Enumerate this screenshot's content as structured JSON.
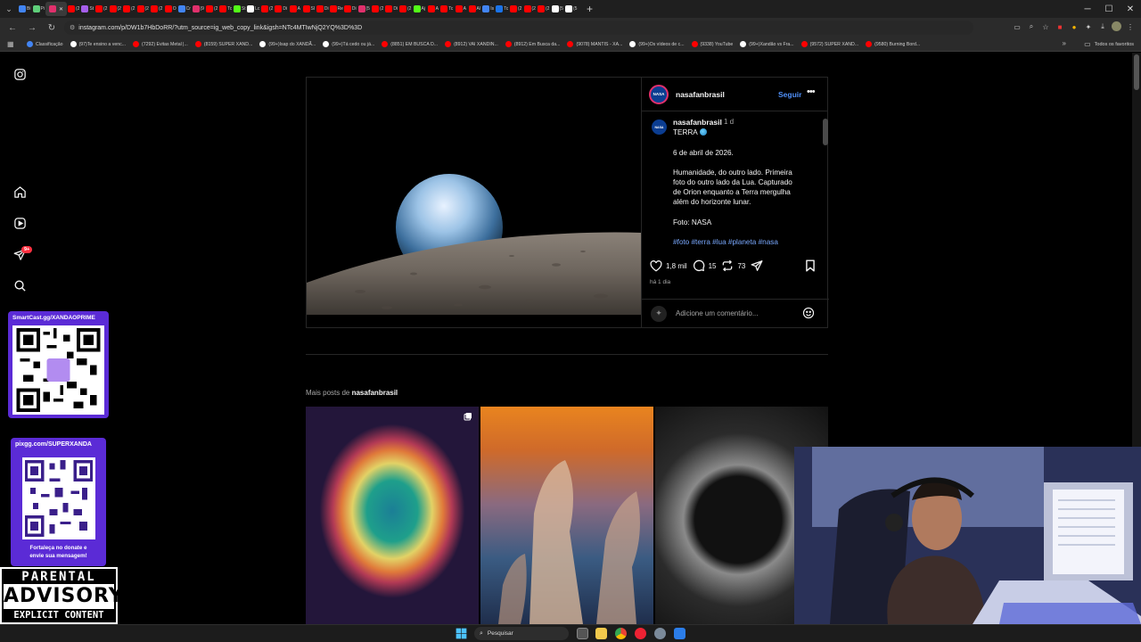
{
  "browser": {
    "url": "instagram.com/p/DW1b7HbDoRR/?utm_source=ig_web_copy_link&igsh=NTc4MTIwNjQ2YQ%3D%3D",
    "tabs": [
      {
        "text": "Bi",
        "color": "#4285f4"
      },
      {
        "text": "Pi",
        "color": "#5fcf7a"
      },
      {
        "text": "",
        "color": "#e1306c",
        "active": true
      },
      {
        "text": "(2",
        "color": "#ff0000"
      },
      {
        "text": "St",
        "color": "#a55eea"
      },
      {
        "text": "(2",
        "color": "#ff0000"
      },
      {
        "text": "(2",
        "color": "#ff0000"
      },
      {
        "text": "(2",
        "color": "#ff0000"
      },
      {
        "text": "(2",
        "color": "#ff0000"
      },
      {
        "text": "(2",
        "color": "#ff0000"
      },
      {
        "text": "O",
        "color": "#ff0000"
      },
      {
        "text": "Cr",
        "color": "#4285f4"
      },
      {
        "text": "(9",
        "color": "#e1306c"
      },
      {
        "text": "(2",
        "color": "#ff0000"
      },
      {
        "text": "Tc",
        "color": "#ff0000"
      },
      {
        "text": "St",
        "color": "#53fc18"
      },
      {
        "text": "Lc",
        "color": "#ffffff"
      },
      {
        "text": "(2",
        "color": "#ff0000"
      },
      {
        "text": "Di",
        "color": "#ff0000"
      },
      {
        "text": "A",
        "color": "#ff0000"
      },
      {
        "text": "Sl",
        "color": "#ff0000"
      },
      {
        "text": "Di",
        "color": "#ff0000"
      },
      {
        "text": "Re",
        "color": "#ff0000"
      },
      {
        "text": "Di",
        "color": "#ff0000"
      },
      {
        "text": "(5",
        "color": "#e1306c"
      },
      {
        "text": "(2",
        "color": "#ff0000"
      },
      {
        "text": "Di",
        "color": "#ff0000"
      },
      {
        "text": "(2",
        "color": "#ff0000"
      },
      {
        "text": "Aj",
        "color": "#53fc18"
      },
      {
        "text": "A",
        "color": "#ff0000"
      },
      {
        "text": "Tc",
        "color": "#ff0000"
      },
      {
        "text": "A",
        "color": "#ff0000"
      },
      {
        "text": "Al",
        "color": "#ff0000"
      },
      {
        "text": "Is",
        "color": "#4285f4"
      },
      {
        "text": "Tc",
        "color": "#1a73e8"
      },
      {
        "text": "(2",
        "color": "#ff0000"
      },
      {
        "text": "(2",
        "color": "#ff0000"
      },
      {
        "text": "(2",
        "color": "#ff0000"
      },
      {
        "text": "(5",
        "color": "#ffffff"
      },
      {
        "text": "(5",
        "color": "#ffffff"
      }
    ],
    "bookmarks": [
      {
        "label": "Classificação",
        "color": "#4285f4"
      },
      {
        "label": "(97)Te ensino a venc...",
        "color": "#ffffff"
      },
      {
        "label": "(7292) Evitas Metal |...",
        "color": "#ff0000"
      },
      {
        "label": "(8159) SUPER XAND...",
        "color": "#ff0000"
      },
      {
        "label": "(99+)Isap do XANDÃ...",
        "color": "#ffffff"
      },
      {
        "label": "(99+)Tá cedo ou já...",
        "color": "#ffffff"
      },
      {
        "label": "(8851) EM BUSCA D...",
        "color": "#ff0000"
      },
      {
        "label": "(8912) VAI XANDIN...",
        "color": "#ff0000"
      },
      {
        "label": "(8912) Em Busca da...",
        "color": "#ff0000"
      },
      {
        "label": "(9078) MANTIS - XA...",
        "color": "#ff0000"
      },
      {
        "label": "(99+)Os vídeos de c...",
        "color": "#ffffff"
      },
      {
        "label": "(9338) YouTube",
        "color": "#ff0000"
      },
      {
        "label": "(99+)Xandão vs Fra...",
        "color": "#ffffff"
      },
      {
        "label": "(9572) SUPER XAND...",
        "color": "#ff0000"
      },
      {
        "label": "(9580) Burning Bord...",
        "color": "#ff0000"
      }
    ],
    "all_bookmarks_label": "Todos os favoritos"
  },
  "post": {
    "username": "nasafanbrasil",
    "avatar_text": "NASA",
    "follow_label": "Seguir",
    "caption_time": "1 d",
    "caption_lines": [
      "TERRA",
      "6 de abril de 2026.",
      "Humanidade, do outro lado. Primeira",
      "foto do outro lado da Lua. Capturado",
      "de Orion enquanto a Terra mergulha",
      "além do horizonte lunar.",
      "Foto: NASA",
      "#foto #terra #lua #planeta #nasa"
    ],
    "likes": "1,8 mil",
    "comments": "15",
    "reposts": "73",
    "date_label": "há 1 dia",
    "comment_placeholder": "Adicione um comentário..."
  },
  "more_posts": {
    "prefix": "Mais posts de ",
    "username": "nasafanbrasil"
  },
  "overlays": {
    "qr1_label": "SmartCast.gg/XANDAOPRIME",
    "qr2_label": "pixgg.com/SUPERXANDA",
    "qr2_footer_1": "Fortaleça no donate e",
    "qr2_footer_2": "envie sua mensagem!",
    "parental_top": "PARENTAL",
    "parental_mid": "ADVISORY",
    "parental_bot": "EXPLICIT CONTENT"
  },
  "sidenav": {
    "notification_badge": "9+"
  },
  "taskbar": {
    "search_label": "Pesquisar"
  },
  "colors": {
    "instagram_blue": "#4f8ff7",
    "hashtag": "#7aa9ff",
    "badge_red": "#ff3040",
    "qr_panel": "#5b2bd6"
  }
}
